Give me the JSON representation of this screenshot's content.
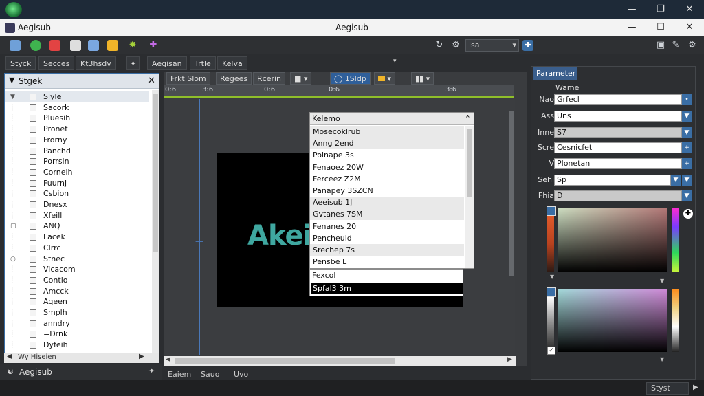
{
  "window": {
    "app_name": "Aegisub",
    "title": "Aegisub"
  },
  "toolbar": {
    "select_value": "lsa"
  },
  "menubar": {
    "items": [
      "Styck",
      "Secces",
      "Kt3hsdv",
      "Aegisan",
      "Trtle",
      "Kelva"
    ]
  },
  "left_panel": {
    "title": "Stgek",
    "items": [
      "Slyle",
      "Sacork",
      "Pluesih",
      "Pronet",
      "Frorny",
      "Panchd",
      "Porrsin",
      "Corneih",
      "Fuurnj",
      "Csbion",
      "Dnesx",
      "Xfeill",
      "ANQ",
      "Lacek",
      "Clrrc",
      "Stnec",
      "Vicacom",
      "Contio",
      "Amcck",
      "Aqeen",
      "Smplh",
      "anndry",
      "=Drnk",
      "Dyfeih"
    ],
    "bottom_label": "Wy Hiseien",
    "footer_label": "Aegisub"
  },
  "center": {
    "controls": [
      "Frkt Slom",
      "Regees",
      "Rcerin",
      "1Sldp"
    ],
    "ruler_ticks": [
      "0:6",
      "3:6",
      "0:6",
      "0:6",
      "3:6"
    ],
    "logo_text": "Akei",
    "dropdown": {
      "header": "Kelemo",
      "items": [
        "Mosecoklrub",
        "Anng 2end",
        "Poinape 3s",
        "Fenaoez 20W",
        "Ferceez Z2M",
        "Panapey 3SZCN",
        "Aeeisub 1J",
        "Gvtanes 7SM",
        "Fenanes 20",
        "Pencheuid",
        "Srechep 7s",
        "Pensbe L"
      ]
    },
    "below_dropdown": [
      "Fexcol",
      "Spfal3 3m"
    ],
    "footer": [
      "Eaiem",
      "Sauo",
      "Uvo"
    ]
  },
  "right_panel": {
    "title": "Parameter",
    "name_label": "Wame",
    "rows": [
      {
        "label": "Nao",
        "value": "Grfecl"
      },
      {
        "label": "Ass",
        "value": "Uns"
      },
      {
        "label": "Inne",
        "value": "S7"
      },
      {
        "label": "Scre",
        "value": "Cesnicfet"
      },
      {
        "label": "V",
        "value": "Plonetan"
      },
      {
        "label": "Sehi",
        "value": "Sp"
      },
      {
        "label": "Fhia",
        "value": "D"
      }
    ]
  },
  "status": {
    "right_button": "Styst"
  }
}
